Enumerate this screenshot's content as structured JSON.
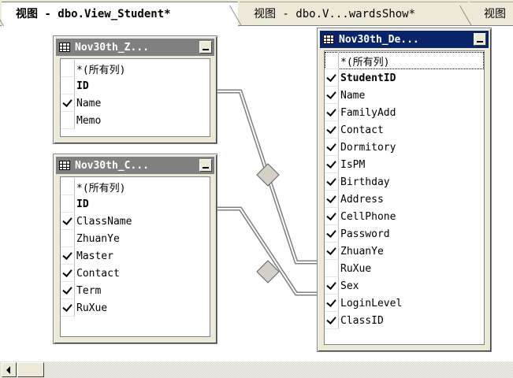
{
  "tabs": [
    {
      "label": "视图 - dbo.View_Student*",
      "active": true
    },
    {
      "label": "视图 - dbo.V...wardsShow*",
      "active": false
    },
    {
      "label": "视图",
      "active": false
    }
  ],
  "tables": {
    "zhuanye": {
      "title": "Nov30th_Z...",
      "columns": [
        {
          "label": "*(所有列)",
          "checked": false,
          "bold": false
        },
        {
          "label": "ID",
          "checked": false,
          "bold": true
        },
        {
          "label": "Name",
          "checked": true,
          "bold": false
        },
        {
          "label": "Memo",
          "checked": false,
          "bold": false
        }
      ]
    },
    "class": {
      "title": "Nov30th_C...",
      "columns": [
        {
          "label": "*(所有列)",
          "checked": false,
          "bold": false
        },
        {
          "label": "ID",
          "checked": false,
          "bold": true
        },
        {
          "label": "ClassName",
          "checked": true,
          "bold": false
        },
        {
          "label": "ZhuanYe",
          "checked": false,
          "bold": false
        },
        {
          "label": "Master",
          "checked": true,
          "bold": false
        },
        {
          "label": "Contact",
          "checked": true,
          "bold": false
        },
        {
          "label": "Term",
          "checked": true,
          "bold": false
        },
        {
          "label": "RuXue",
          "checked": true,
          "bold": false
        }
      ]
    },
    "student": {
      "title": "Nov30th_De...",
      "columns": [
        {
          "label": "*(所有列)",
          "checked": false,
          "bold": false
        },
        {
          "label": "StudentID",
          "checked": true,
          "bold": true
        },
        {
          "label": "Name",
          "checked": true,
          "bold": false
        },
        {
          "label": "FamilyAdd",
          "checked": true,
          "bold": false
        },
        {
          "label": "Contact",
          "checked": true,
          "bold": false
        },
        {
          "label": "Dormitory",
          "checked": true,
          "bold": false
        },
        {
          "label": "IsPM",
          "checked": true,
          "bold": false
        },
        {
          "label": "Birthday",
          "checked": true,
          "bold": false
        },
        {
          "label": "Address",
          "checked": true,
          "bold": false
        },
        {
          "label": "CellPhone",
          "checked": true,
          "bold": false
        },
        {
          "label": "Password",
          "checked": true,
          "bold": false
        },
        {
          "label": "ZhuanYe",
          "checked": true,
          "bold": false
        },
        {
          "label": "RuXue",
          "checked": false,
          "bold": false
        },
        {
          "label": "Sex",
          "checked": true,
          "bold": false
        },
        {
          "label": "LoginLevel",
          "checked": true,
          "bold": false
        },
        {
          "label": "ClassID",
          "checked": true,
          "bold": false
        }
      ]
    }
  },
  "colors": {
    "active_title": "#0a246a",
    "inactive_title": "#808080",
    "window_face": "#ece9d8"
  },
  "icons": [
    "grid-icon",
    "minimize-icon",
    "diamond-join-icon",
    "scroll-left-arrow-icon"
  ]
}
